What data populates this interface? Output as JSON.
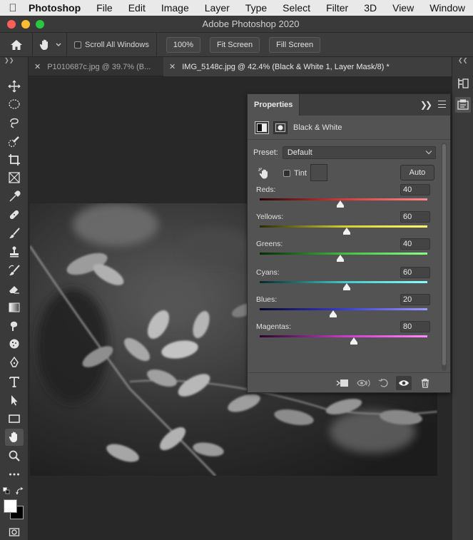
{
  "menubar": {
    "app": "Photoshop",
    "items": [
      "File",
      "Edit",
      "Image",
      "Layer",
      "Type",
      "Select",
      "Filter",
      "3D",
      "View",
      "Window"
    ]
  },
  "window": {
    "title": "Adobe Photoshop 2020"
  },
  "options": {
    "scroll_all_windows": "Scroll All Windows",
    "zoom_btn": "100%",
    "fit_screen": "Fit Screen",
    "fill_screen": "Fill Screen"
  },
  "tabs": [
    {
      "label": "P1010687c.jpg @ 39.7% (B...",
      "active": false
    },
    {
      "label": "IMG_5148c.jpg @ 42.4% (Black & White 1, Layer Mask/8) *",
      "active": true
    }
  ],
  "properties": {
    "tab": "Properties",
    "adjustment": "Black & White",
    "preset_label": "Preset:",
    "preset_value": "Default",
    "tint_label": "Tint",
    "tint_checked": false,
    "auto_label": "Auto",
    "sliders": [
      {
        "name": "Reds:",
        "value": "40",
        "fraction": 0.48,
        "gradient": [
          "#2a0505",
          "#d63a3a",
          "#ff8a8a"
        ]
      },
      {
        "name": "Yellows:",
        "value": "60",
        "fraction": 0.52,
        "gradient": [
          "#2a2a05",
          "#cfcf30",
          "#ffff70"
        ]
      },
      {
        "name": "Greens:",
        "value": "40",
        "fraction": 0.48,
        "gradient": [
          "#052a05",
          "#3fbf3f",
          "#8aff8a"
        ]
      },
      {
        "name": "Cyans:",
        "value": "60",
        "fraction": 0.52,
        "gradient": [
          "#052a2a",
          "#3fc8c8",
          "#8affff"
        ]
      },
      {
        "name": "Blues:",
        "value": "20",
        "fraction": 0.44,
        "gradient": [
          "#05052a",
          "#3a3ad6",
          "#9a9aff"
        ]
      },
      {
        "name": "Magentas:",
        "value": "80",
        "fraction": 0.56,
        "gradient": [
          "#2a052a",
          "#c83ac8",
          "#ff8aff"
        ]
      }
    ]
  },
  "colors": {
    "panel_bg": "#535353",
    "chrome_bg": "#3a3a3a",
    "canvas_bg": "#282828"
  }
}
